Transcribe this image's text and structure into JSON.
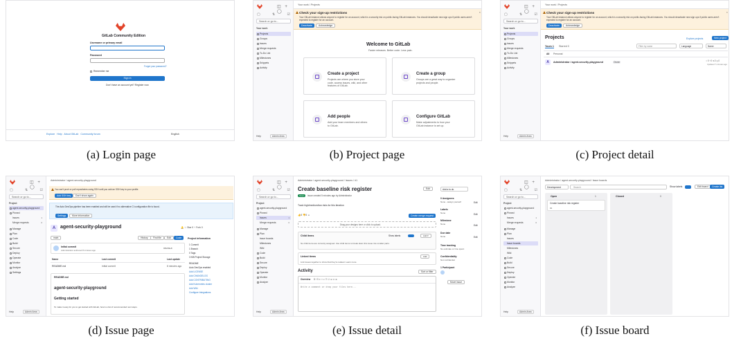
{
  "captions": [
    {
      "label": "(a) Login page"
    },
    {
      "label": "(b) Project page"
    },
    {
      "label": "(c) Project detail"
    },
    {
      "label": "(d) Issue page"
    },
    {
      "label": "(e) Issue detail"
    },
    {
      "label": "(f) Issue board"
    }
  ],
  "login": {
    "title": "GitLab Community Edition",
    "username_label": "Username or primary email",
    "password_label": "Password",
    "forgot": "Forgot your password?",
    "remember": "Remember me",
    "sign_in": "Sign in",
    "register": "Don't have an account yet? Register now",
    "footer": "Explore   Help   About GitLab   Community forum",
    "language": "English"
  },
  "sidebar": {
    "search": "Search or go to...",
    "your_work": "Your work",
    "project_label": "Project",
    "project_name": "agent-security-playground",
    "items_main": [
      "Projects",
      "Groups",
      "Issues",
      "Merge requests",
      "To-Do List",
      "Milestones",
      "Snippets",
      "Activity"
    ],
    "items_project": [
      "Pinned",
      "Issues",
      "Merge requests",
      "Manage",
      "Plan",
      "Code",
      "Build",
      "Secure",
      "Deploy",
      "Operate",
      "Monitor",
      "Analyze",
      "Settings"
    ],
    "items_plan": [
      "Issue boards",
      "Milestones",
      "Wiki"
    ],
    "help": "Help",
    "admin": "Admin Area"
  },
  "banner": {
    "title": "Check your sign-up restrictions",
    "body": "Your GitLab instance allows anyone to register for an account, which is a security risk on public-facing GitLab instances. You should deactivate new sign ups if public users aren't expected to register for an account.",
    "deactivate": "Deactivate",
    "acknowledge": "Acknowledge"
  },
  "project_page": {
    "breadcrumb": "Your work / Projects",
    "welcome": "Welcome to GitLab",
    "tagline": "Faster releases. Better code. Less pain.",
    "cards": [
      {
        "title": "Create a project",
        "desc": "Projects are where you store your code, access issues, wiki, and other features of GitLab."
      },
      {
        "title": "Create a group",
        "desc": "Groups are a great way to organize projects and people."
      },
      {
        "title": "Add people",
        "desc": "Add your team members and others to GitLab."
      },
      {
        "title": "Configure GitLab",
        "desc": "Make adjustments to how your GitLab instance is set up."
      }
    ]
  },
  "project_detail": {
    "breadcrumb": "Your work / Projects",
    "heading": "Projects",
    "explore": "Explore projects",
    "new_project": "New project",
    "tabs": [
      "Yours 1",
      "Starred 0"
    ],
    "filter_placeholder": "Filter by name",
    "language": "Language",
    "sort": "Name",
    "subtabs": [
      "All",
      "Personal"
    ],
    "row": "Administrator / agent-security-playground",
    "role": "Owner",
    "updated": "Updated 7 minutes ago"
  },
  "issue_page": {
    "breadcrumb": "Administrator / agent-security-playground",
    "ssh_warning": "You can't push or pull repositories using SSH until you add an SSH key to your profile.",
    "add_ssh": "Add SSH key",
    "dont_show": "Don't show again",
    "devops_msg": "The Auto DevOps pipeline has been enabled and will be used if no alternative CI configuration file is found.",
    "settings": "Settings",
    "more_info": "More information",
    "project_title": "agent-security-playground",
    "commit": "Initial commit",
    "commit_meta": "Administrator authored 8 minutes ago",
    "commit_sha": "9f3203e8",
    "columns": [
      "Name",
      "Last commit",
      "Last update"
    ],
    "file": "README.md",
    "file_commit": "Initial commit",
    "file_updated": "8 minutes ago",
    "readme_title": "agent-security-playground",
    "getting_started": "Getting started",
    "readme_text": "To make it easy for you to get started with GitLab, here's a list of recommended next steps.",
    "project_info": "Project information",
    "info_items": [
      "1 Commit",
      "1 Branch",
      "0 Tags",
      "3 KiB Project Storage"
    ],
    "links": [
      "README",
      "Auto DevOps enabled",
      "Add LICENSE",
      "Add CHANGELOG",
      "Add CONTRIBUTING",
      "Add Kubernetes cluster",
      "Add Wiki",
      "Configure Integrations"
    ],
    "buttons": [
      "History",
      "Find file",
      "Edit",
      "Code"
    ],
    "branch": "main"
  },
  "issue_detail": {
    "breadcrumb": "Administrator / agent-security-playground / Issues / #1",
    "title": "Create baseline risk register",
    "status": "Open",
    "meta": "Issue created 5 minutes ago by Administrator",
    "desc": "Track high/medium/low risks for this iteration",
    "drop": "Drag your designs here or click to upload.",
    "create_mr": "Create merge request",
    "child_items": "Child items",
    "child_empty": "No child items are currently assigned. Use child items to break down this issue into smaller parts.",
    "show_labels": "Show labels",
    "linked_items": "Linked items",
    "linked_empty": "Link issues together to show that they're related. Learn more.",
    "activity": "Activity",
    "sort": "Sort or filter",
    "overview": "Overview",
    "comment_placeholder": "Write a comment or drag your files here...",
    "add_todo": "Add a to do",
    "sidebar": [
      {
        "label": "0 Assignees",
        "value": "None - assign yourself"
      },
      {
        "label": "Labels",
        "value": "None"
      },
      {
        "label": "Milestone",
        "value": "None"
      },
      {
        "label": "Due date",
        "value": "None"
      },
      {
        "label": "Time tracking",
        "value": "No estimate or time spent"
      },
      {
        "label": "Confidentiality",
        "value": "Not confidential"
      },
      {
        "label": "1 Participant",
        "value": ""
      }
    ],
    "move": "Move issue",
    "edit": "Edit"
  },
  "issue_board": {
    "breadcrumb": "Administrator / agent-security-playground / Issue boards",
    "board": "Development",
    "search": "Search",
    "show_labels": "Show labels",
    "edit_board": "Edit board",
    "create_list": "Create list",
    "open": "Open",
    "open_count": "1",
    "closed": "Closed",
    "closed_count": "0",
    "card_title": "Create baseline risk register",
    "card_ref": "#1"
  },
  "colors": {
    "accent": "#1f75cb",
    "banner": "#fdf1dd",
    "gitlab_orange": "#e24329",
    "sidebar_active": "#dcdcf7"
  }
}
